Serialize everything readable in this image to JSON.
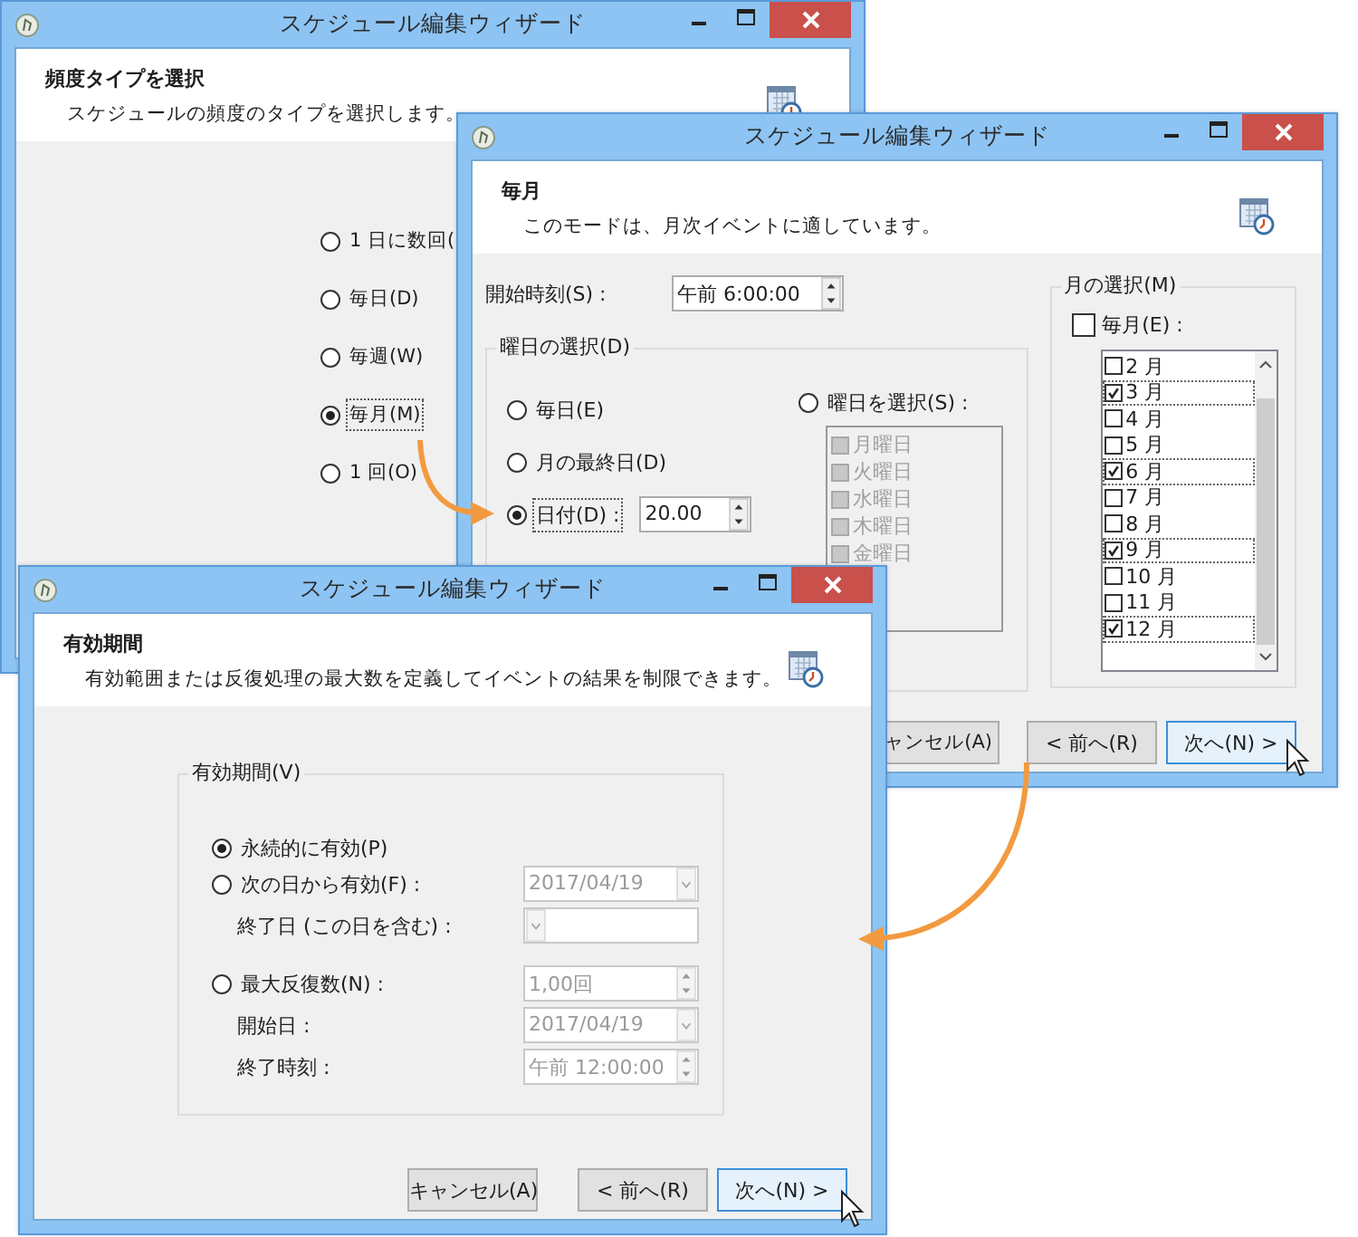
{
  "frequency_window": {
    "title": "スケジュール編集ウィザード",
    "heading": "頻度タイプを選択",
    "description": "スケジュールの頻度のタイプを選択します。",
    "options": [
      {
        "label": "1 日に数回(",
        "selected": false,
        "focused": false
      },
      {
        "label": "毎日(D)",
        "selected": false,
        "focused": false
      },
      {
        "label": "毎週(W)",
        "selected": false,
        "focused": false
      },
      {
        "label": "毎月(M)",
        "selected": true,
        "focused": true
      },
      {
        "label": "1 回(O)",
        "selected": false,
        "focused": false
      }
    ]
  },
  "monthly_window": {
    "title": "スケジュール編集ウィザード",
    "heading": "毎月",
    "description": "このモードは、月次イベントに適しています。",
    "start_time": {
      "label": "開始時刻(S) :",
      "value": "午前 6:00:00"
    },
    "weekday_group": {
      "label": "曜日の選択(D)",
      "options": [
        {
          "label": "毎日(E)",
          "selected": false,
          "focused": false
        },
        {
          "label": "月の最終日(D)",
          "selected": false,
          "focused": false
        },
        {
          "label": "日付(D) :",
          "selected": true,
          "focused": true,
          "value": "20.00"
        }
      ],
      "select_weekday": {
        "label": "曜日を選択(S) :",
        "selected": false
      },
      "weekdays": {
        "disabled": true,
        "items": [
          "月曜日",
          "火曜日",
          "水曜日",
          "木曜日",
          "金曜日"
        ]
      }
    },
    "month_group": {
      "label": "月の選択(M)",
      "every_month": {
        "label": "毎月(E) :",
        "checked": false
      },
      "months": [
        {
          "label": "2 月",
          "checked": false
        },
        {
          "label": "3 月",
          "checked": true
        },
        {
          "label": "4 月",
          "checked": false
        },
        {
          "label": "5 月",
          "checked": false
        },
        {
          "label": "6 月",
          "checked": true
        },
        {
          "label": "7 月",
          "checked": false
        },
        {
          "label": "8 月",
          "checked": false
        },
        {
          "label": "9 月",
          "checked": true
        },
        {
          "label": "10 月",
          "checked": false
        },
        {
          "label": "11 月",
          "checked": false
        },
        {
          "label": "12 月",
          "checked": true
        }
      ]
    },
    "buttons": [
      {
        "label": "ャンセル(A)",
        "highlighted": false
      },
      {
        "label": "< 前へ(R)",
        "highlighted": false
      },
      {
        "label": "次へ(N) >",
        "highlighted": true
      }
    ]
  },
  "validity_window": {
    "title": "スケジュール編集ウィザード",
    "heading": "有効期間",
    "description": "有効範囲または反復処理の最大数を定義してイベントの結果を制限できます。",
    "group": {
      "label": "有効期間(V)",
      "rows": [
        {
          "kind": "radio",
          "label": "永続的に有効(P)",
          "selected": true
        },
        {
          "kind": "radio",
          "label": "次の日から有効(F) :",
          "selected": false,
          "field": {
            "kind": "dropdown",
            "value": "2017/04/19",
            "disabled": true
          }
        },
        {
          "kind": "label",
          "label": "終了日 (この日を含む) :",
          "field": {
            "kind": "dropdown"
          }
        },
        {
          "kind": "radio",
          "label": "最大反復数(N) :",
          "selected": false,
          "field": {
            "kind": "spin",
            "value": "1,00回",
            "disabled": true
          }
        },
        {
          "kind": "label",
          "label": "開始日 :",
          "field": {
            "kind": "dropdown",
            "value": "2017/04/19",
            "disabled": true
          }
        },
        {
          "kind": "label",
          "label": "終了時刻 :",
          "field": {
            "kind": "spin",
            "value": "午前 12:00:00",
            "disabled": true
          }
        }
      ]
    },
    "buttons": [
      {
        "label": "キャンセル(A)",
        "highlighted": false
      },
      {
        "label": "< 前へ(R)",
        "highlighted": false
      },
      {
        "label": "次へ(N) >",
        "highlighted": true
      }
    ]
  }
}
